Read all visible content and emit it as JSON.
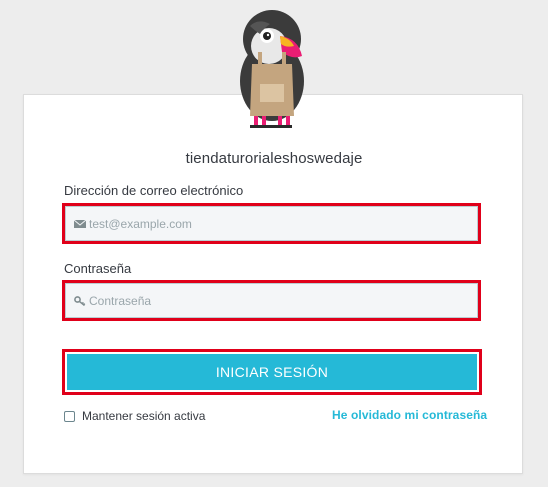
{
  "brand": {
    "logo_icon": "puffin-mascot-icon",
    "shop_name": "tiendaturorialeshoswedaje"
  },
  "form": {
    "email_label": "Dirección de correo electrónico",
    "email_placeholder": "test@example.com",
    "email_icon": "envelope-icon",
    "password_label": "Contraseña",
    "password_placeholder": "Contraseña",
    "password_icon": "key-icon",
    "submit_label": "INICIAR SESIÓN",
    "stay_logged_in_label": "Mantener sesión activa",
    "stay_logged_in_checked": false,
    "forgot_password_label": "He olvidado mi contraseña"
  },
  "colors": {
    "accent": "#25b9d7",
    "highlight": "#e0001a",
    "text": "#363a41",
    "background": "#ededed"
  }
}
